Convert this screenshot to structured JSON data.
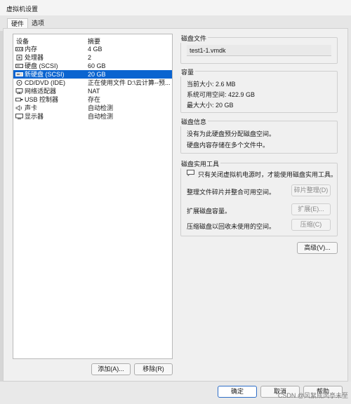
{
  "window": {
    "title": "虚拟机设置"
  },
  "tabs": [
    {
      "label": "硬件"
    },
    {
      "label": "选项"
    }
  ],
  "device_list": {
    "header": {
      "device": "设备",
      "summary": "摘要"
    },
    "rows": [
      {
        "icon": "memory-icon",
        "name": "内存",
        "summary": "4 GB"
      },
      {
        "icon": "cpu-icon",
        "name": "处理器",
        "summary": "2"
      },
      {
        "icon": "hard-disk-icon",
        "name": "硬盘 (SCSI)",
        "summary": "60 GB"
      },
      {
        "icon": "hard-disk-icon",
        "name": "新硬盘 (SCSI)",
        "summary": "20 GB",
        "selected": true
      },
      {
        "icon": "cd-dvd-icon",
        "name": "CD/DVD (IDE)",
        "summary": "正在使用文件 D:\\云计算--预..."
      },
      {
        "icon": "network-adapter-icon",
        "name": "网络适配器",
        "summary": "NAT"
      },
      {
        "icon": "usb-icon",
        "name": "USB 控制器",
        "summary": "存在"
      },
      {
        "icon": "speaker-icon",
        "name": "声卡",
        "summary": "自动检测"
      },
      {
        "icon": "display-icon",
        "name": "显示器",
        "summary": "自动检测"
      }
    ],
    "add_label": "添加(A)...",
    "remove_label": "移除(R)"
  },
  "disk_file": {
    "title": "磁盘文件",
    "value": "test1-1.vmdk"
  },
  "capacity": {
    "title": "容量",
    "current_size": "当前大小: 2.6 MB",
    "available": "系统可用空间: 422.9 GB",
    "max_size": "最大大小: 20 GB"
  },
  "disk_info": {
    "title": "磁盘信息",
    "line1": "没有为此硬盘预分配磁盘空间。",
    "line2": "硬盘内容存储在多个文件中。"
  },
  "utilities": {
    "title": "磁盘实用工具",
    "note": "只有关闭虚拟机电源时，才能使用磁盘实用工具。",
    "defrag_text": "整理文件碎片并整合可用空间。",
    "defrag_button": "碎片整理(D)",
    "expand_text": "扩展磁盘容量。",
    "expand_button": "扩展(E)...",
    "compact_text": "压缩磁盘以回收未使用的空间。",
    "compact_button": "压缩(C)"
  },
  "advanced_button": "高级(V)...",
  "footer": {
    "ok": "确定",
    "cancel": "取消",
    "help": "帮助"
  },
  "watermark": "CSDN @风絮成风亭未至",
  "colors": {
    "selection": "#0a64d0",
    "panel": "#f0f0f0",
    "list_bg": "#ffffff"
  }
}
